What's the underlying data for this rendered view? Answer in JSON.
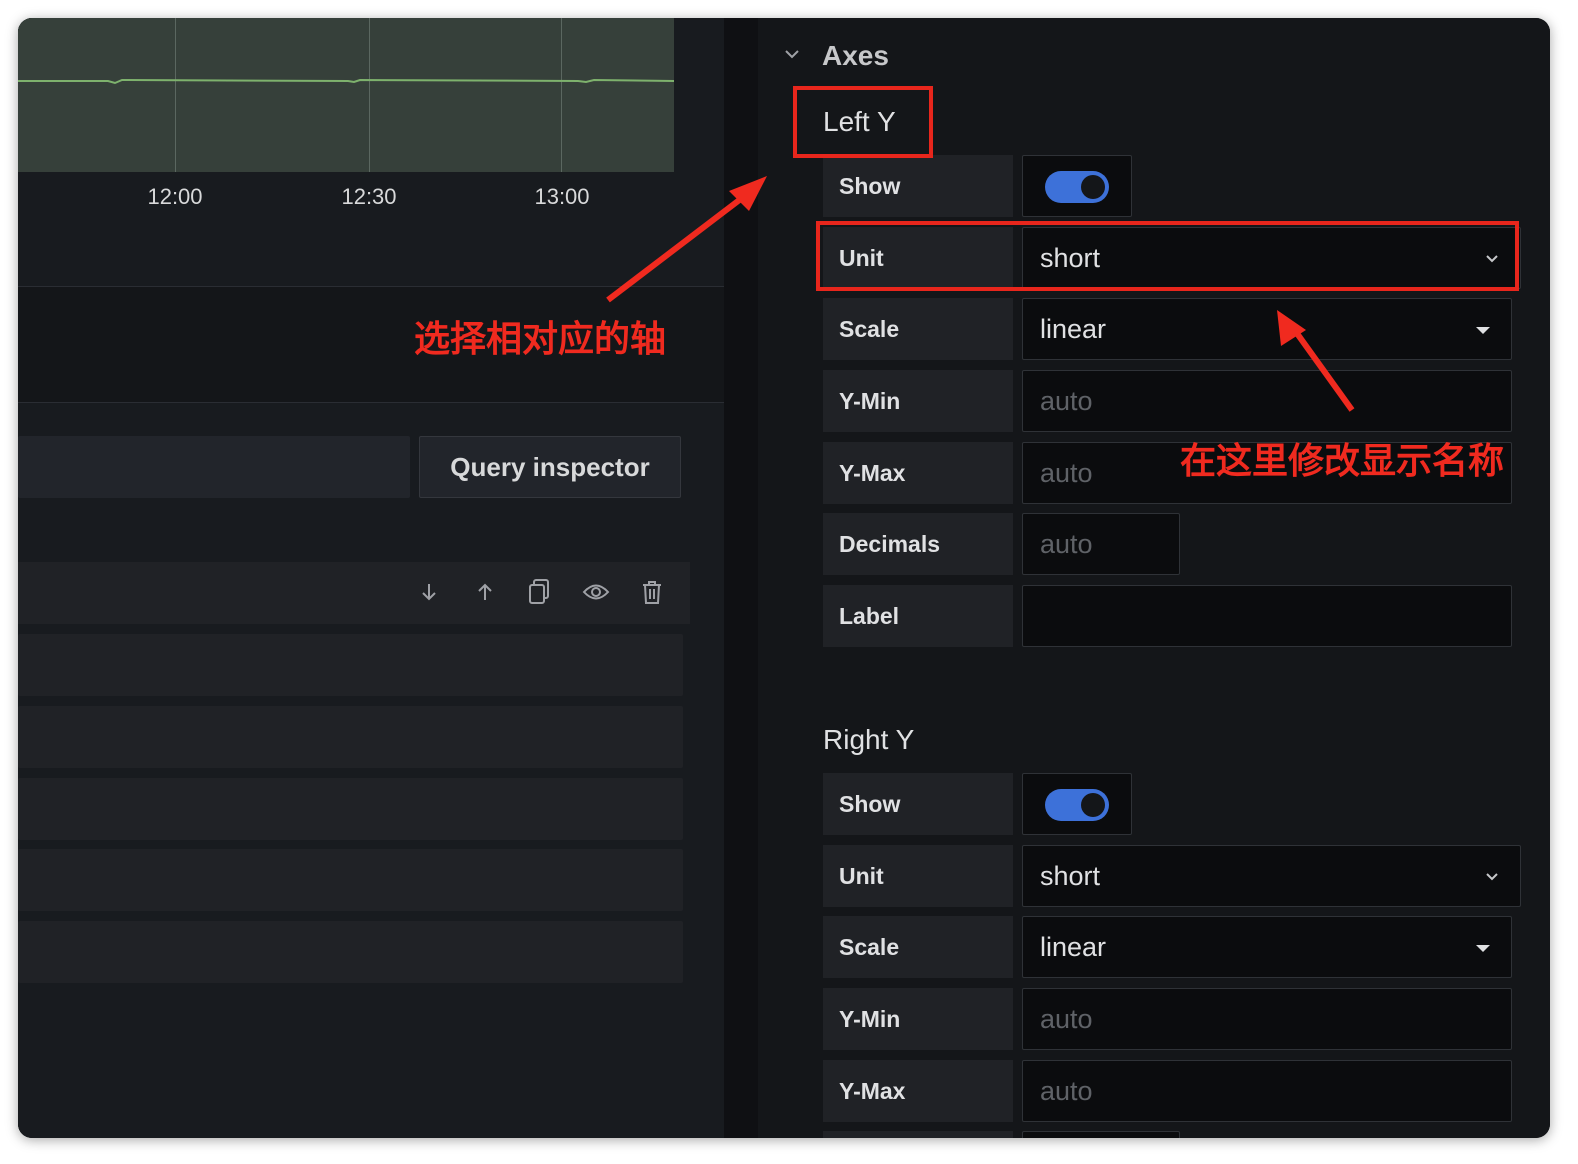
{
  "graph": {
    "x_ticks": [
      "12:00",
      "12:30",
      "13:00"
    ]
  },
  "query_editor": {
    "query_inspector_label": "Query inspector",
    "row_icons": [
      "arrow-down-icon",
      "arrow-up-icon",
      "duplicate-icon",
      "eye-icon",
      "trash-icon"
    ]
  },
  "axes": {
    "section_label": "Axes",
    "left_y": {
      "title": "Left Y",
      "show_label": "Show",
      "show_value": true,
      "unit_label": "Unit",
      "unit_value": "short",
      "scale_label": "Scale",
      "scale_value": "linear",
      "ymin_label": "Y-Min",
      "ymin_placeholder": "auto",
      "ymax_label": "Y-Max",
      "ymax_placeholder": "auto",
      "decimals_label": "Decimals",
      "decimals_placeholder": "auto",
      "label_label": "Label",
      "label_value": ""
    },
    "right_y": {
      "title": "Right Y",
      "show_label": "Show",
      "show_value": true,
      "unit_label": "Unit",
      "unit_value": "short",
      "scale_label": "Scale",
      "scale_value": "linear",
      "ymin_label": "Y-Min",
      "ymin_placeholder": "auto",
      "ymax_label": "Y-Max",
      "ymax_placeholder": "auto"
    }
  },
  "annotations": {
    "select_axis": "选择相对应的轴",
    "modify_name": "在这里修改显示名称"
  },
  "colors": {
    "accent_blue": "#3d71d9",
    "annotation_red": "#e8261c",
    "plot_line": "#7eb26d"
  }
}
